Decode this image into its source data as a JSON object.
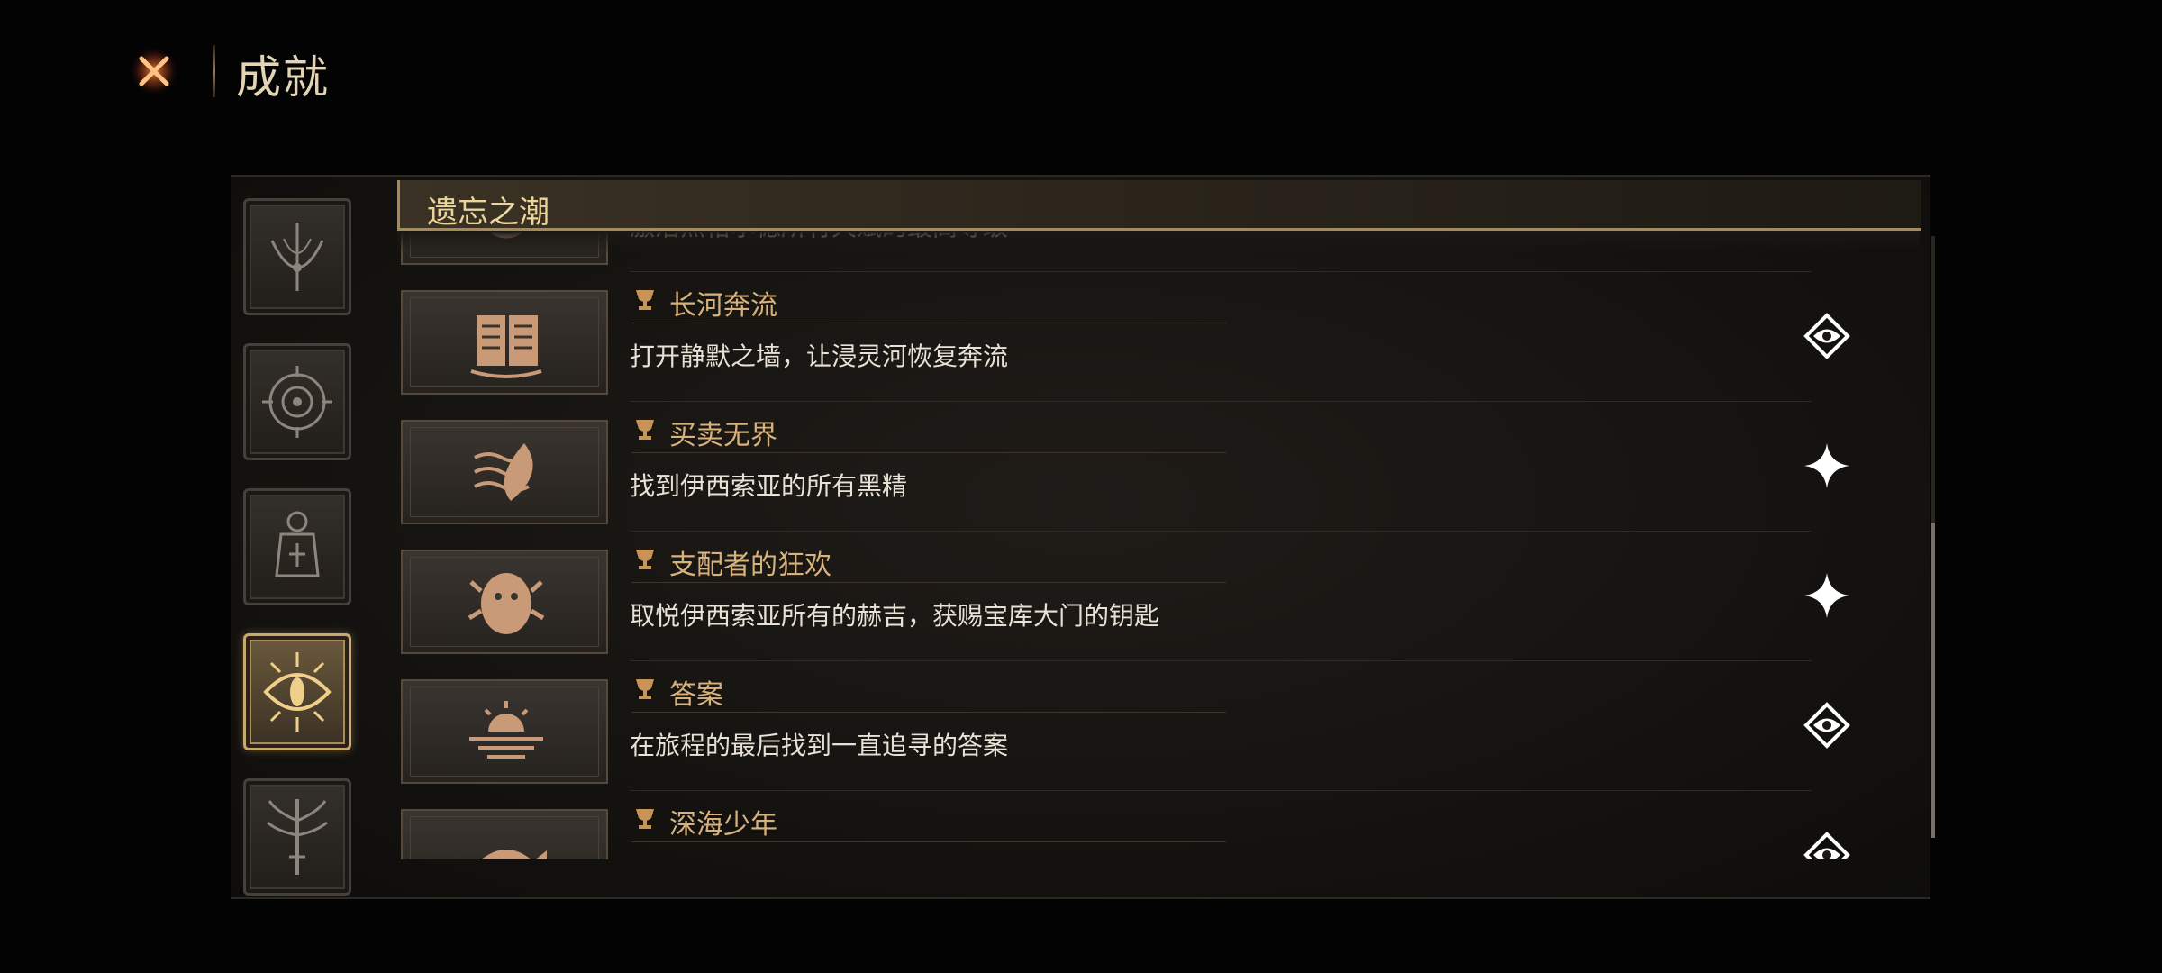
{
  "header": {
    "title": "成就",
    "close_icon": "close-x-icon"
  },
  "colors": {
    "accent_gold": "#c9a870",
    "title_text": "#d8b27c",
    "status_white": "#ffffff"
  },
  "categories": [
    {
      "icon": "scythe-emblem-icon",
      "active": false
    },
    {
      "icon": "compass-eye-icon",
      "active": false
    },
    {
      "icon": "lantern-figure-icon",
      "active": false
    },
    {
      "icon": "radiant-eye-icon",
      "active": true
    },
    {
      "icon": "tree-sword-icon",
      "active": false
    }
  ],
  "section": {
    "title": "遗忘之潮"
  },
  "achievements": [
    {
      "name": "",
      "description": "激活杰格尔德所有天赋的最高等级",
      "icon": "medallion-icon",
      "status": "none"
    },
    {
      "name": "长河奔流",
      "description": "打开静默之墙，让浸灵河恢复奔流",
      "icon": "open-book-icon",
      "status": "eye-emblem"
    },
    {
      "name": "买卖无界",
      "description": "找到伊西索亚的所有黑精",
      "icon": "wave-leaf-icon",
      "status": "sparkle"
    },
    {
      "name": "支配者的狂欢",
      "description": "取悦伊西索亚所有的赫吉，获赐宝库大门的钥匙",
      "icon": "beast-icon",
      "status": "sparkle"
    },
    {
      "name": "答案",
      "description": "在旅程的最后找到一直追寻的答案",
      "icon": "sunset-icon",
      "status": "eye-emblem"
    },
    {
      "name": "深海少年",
      "description": "",
      "icon": "fish-icon",
      "status": "eye-emblem"
    }
  ]
}
